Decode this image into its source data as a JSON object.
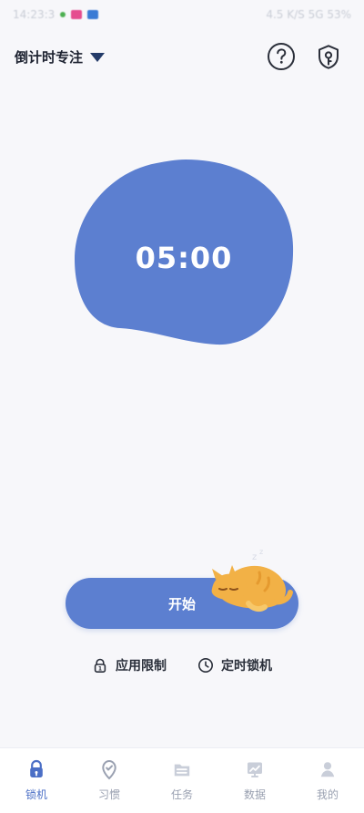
{
  "status_bar": {
    "time": "14:23:3",
    "right_text": "4.5 K/S  5G  53%"
  },
  "header": {
    "mode_label": "倒计时专注",
    "help_icon": "question-circle-icon",
    "shield_icon": "shield-key-icon"
  },
  "timer": {
    "display": "05:00",
    "blob_color": "#5c7fd0"
  },
  "actions": {
    "start_label": "开始",
    "app_limit_label": "应用限制",
    "scheduled_lock_label": "定时锁机"
  },
  "bottom_nav": {
    "items": [
      {
        "label": "锁机",
        "icon": "lock-icon",
        "active": true
      },
      {
        "label": "习惯",
        "icon": "location-check-icon",
        "active": false
      },
      {
        "label": "任务",
        "icon": "folder-list-icon",
        "active": false
      },
      {
        "label": "数据",
        "icon": "chart-board-icon",
        "active": false
      },
      {
        "label": "我的",
        "icon": "user-icon",
        "active": false
      }
    ]
  },
  "colors": {
    "accent": "#5c7fd0",
    "nav_active": "#4b6fc6",
    "nav_inactive": "#9aa1b1"
  }
}
